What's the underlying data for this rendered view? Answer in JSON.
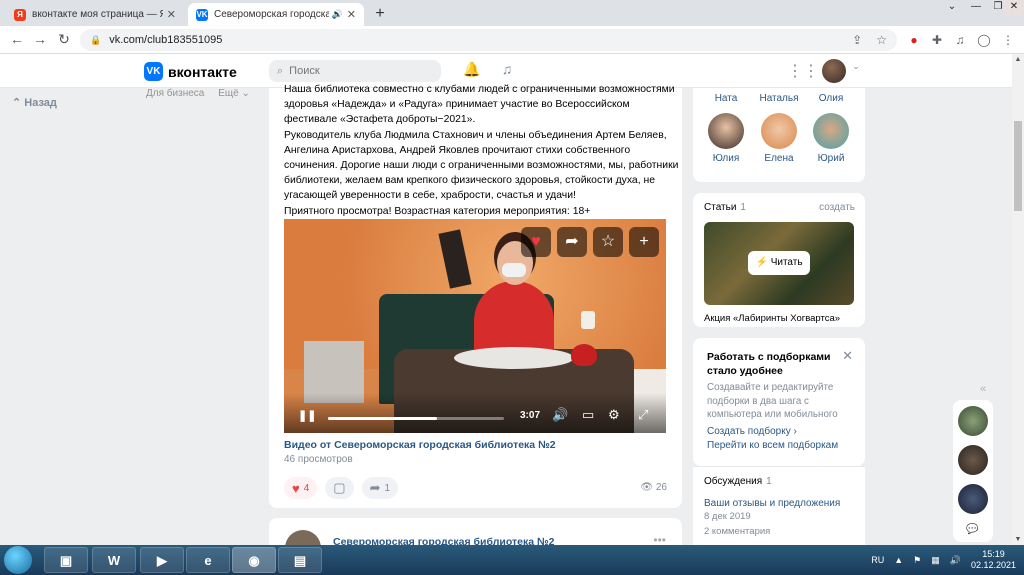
{
  "browser": {
    "tabs": [
      {
        "title": "вконтакте моя страница — Янд",
        "favicon_color": "#f23a1c",
        "favicon_letter": "Я"
      },
      {
        "title": "Североморская городская б",
        "favicon_color": "#0077ff",
        "favicon_letter": "VK"
      }
    ],
    "url": "vk.com/club183551095"
  },
  "vk": {
    "logo_text": "вконтакте",
    "search_placeholder": "Поиск",
    "left_nav_back": "Назад",
    "submenu": [
      "Для бизнеса",
      "Ещё"
    ]
  },
  "post": {
    "text": "Наша библиотека совместно с клубами людей с ограниченными возможностями здоровья «Надежда» и «Радуга» принимает участие во Всероссийском фестивале «Эстафета доброты−2021».\nРуководитель клуба Людмила Стахнович и члены объединения Артем Беляев, Ангелина Аристархова, Андрей Яковлев прочитают стихи собственного сочинения. Дорогие наши люди с ограниченными возможностями, мы, работники библиотеки, желаем вам крепкого физического здоровья, стойкости духа, не угасающей уверенности в себе, храбрости, счастья и удачи!\nПриятного просмотра! Возрастная категория мероприятия: 18+",
    "video": {
      "time": "3:07",
      "progress": 0.62,
      "title": "Видео от Североморская городская библиотека №2",
      "views": "46 просмотров"
    },
    "likes": "4",
    "shares": "1",
    "view_count": "26"
  },
  "next_post": {
    "author": "Североморская городская библиотека №2"
  },
  "members": {
    "row1": [
      "Ната",
      "Наталья",
      "Олия"
    ],
    "row2": [
      "Юлия",
      "Елена",
      "Юрий"
    ]
  },
  "articles": {
    "title": "Статьи",
    "count": "1",
    "create": "создать",
    "read_button": "Читать",
    "article_title": "Акция «Лабиринты Хогвартса»"
  },
  "promo": {
    "title": "Работать с подборками стало удобнее",
    "description": "Создавайте и редактируйте подборки в два шага с компьютера или мобильного",
    "link1": "Создать подборку ›",
    "link2": "Перейти ко всем подборкам"
  },
  "discussions": {
    "title": "Обсуждения",
    "count": "1",
    "topic": "Ваши отзывы и предложения",
    "date": "8 дек 2019",
    "comments": "2 комментария"
  },
  "taskbar": {
    "language": "RU",
    "time": "15:19",
    "date": "02.12.2021"
  },
  "colors": {
    "vk_blue": "#0077ff",
    "link": "#2a5885",
    "like_red": "#e64646"
  }
}
